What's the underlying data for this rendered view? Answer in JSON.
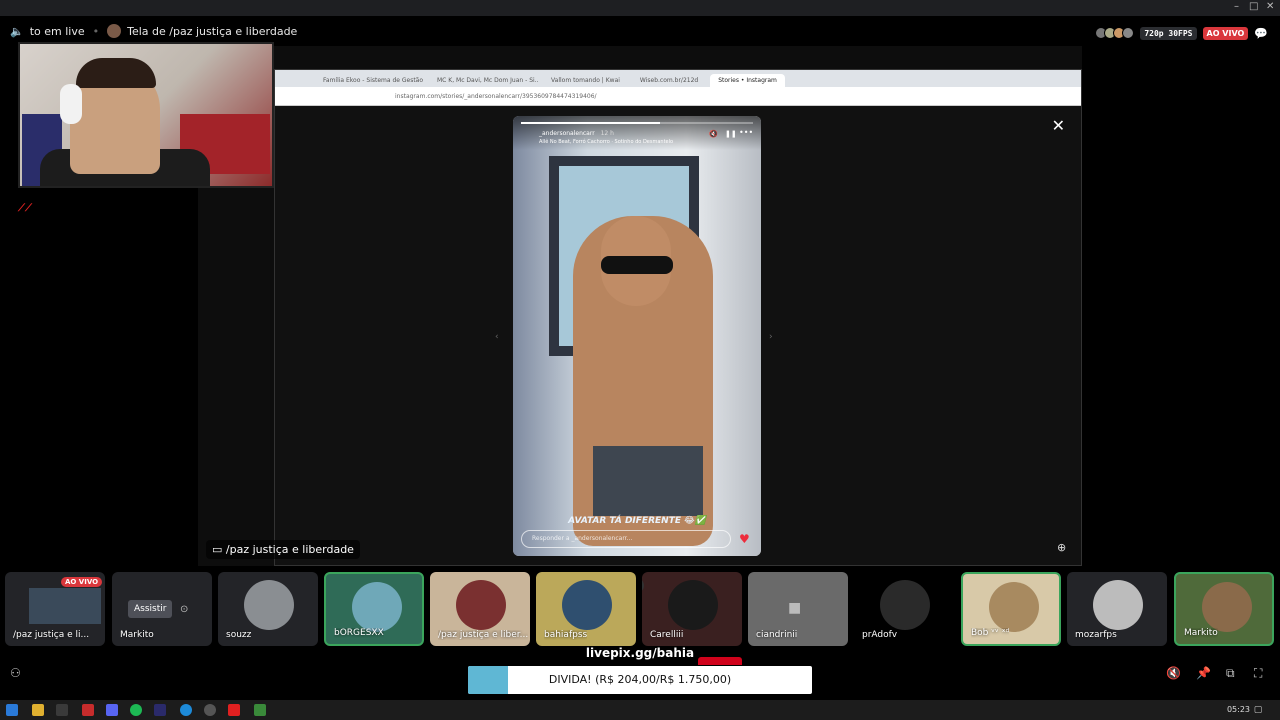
{
  "window": {
    "min": "–",
    "max": "□",
    "close": "✕"
  },
  "header": {
    "channel": "to em live",
    "stream_title": "Tela de /paz justiça e liberdade",
    "quality": "720p 30FPS",
    "live": "AO VIVO"
  },
  "browser": {
    "tabs": [
      "Família Ekoo - Sistema de Gestão",
      "MC K, Mc Davi, Mc Dom Juan - Si...",
      "Vallom tomando | Kwai",
      "Wiseb.com.br/212d",
      "Stories • Instagram"
    ],
    "url": "instagram.com/stories/_andersonalencarr/3953609784474319406/"
  },
  "story": {
    "username": "_andersonalencarr",
    "time": "12 h",
    "music": "Allê No Beat, Forró Cachorro · Sotinho do Desmantelo",
    "caption": "AVATAR TÁ DIFERENTE 😂✅",
    "reply_placeholder": "Responder a _andersonalencarr..."
  },
  "stage_label": "/paz justiça e liberdade",
  "tiles": [
    {
      "label": "/paz justiça e li...",
      "live": "AO VIVO"
    },
    {
      "label": "Markito",
      "button": "Assistir"
    },
    {
      "label": "souzz"
    },
    {
      "label": "bORGESXX"
    },
    {
      "label": "/paz justiça e liber..."
    },
    {
      "label": "bahiafpss"
    },
    {
      "label": "Carelliii"
    },
    {
      "label": "ciandrinii"
    },
    {
      "label": "prAdofv"
    },
    {
      "label": "Bob ᵛᵛ ˣᵈ"
    },
    {
      "label": "mozarfps"
    },
    {
      "label": "Markito"
    }
  ],
  "donation": {
    "site": "livepix.gg/bahia",
    "text": "DIVIDA! (R$ 204,00/R$ 1.750,00)",
    "progress_fraction": 0.117
  },
  "clock": "05:23",
  "colors": {
    "live": "#da373c",
    "speaking": "#3ba55c",
    "progress": "#5fb7d4"
  }
}
